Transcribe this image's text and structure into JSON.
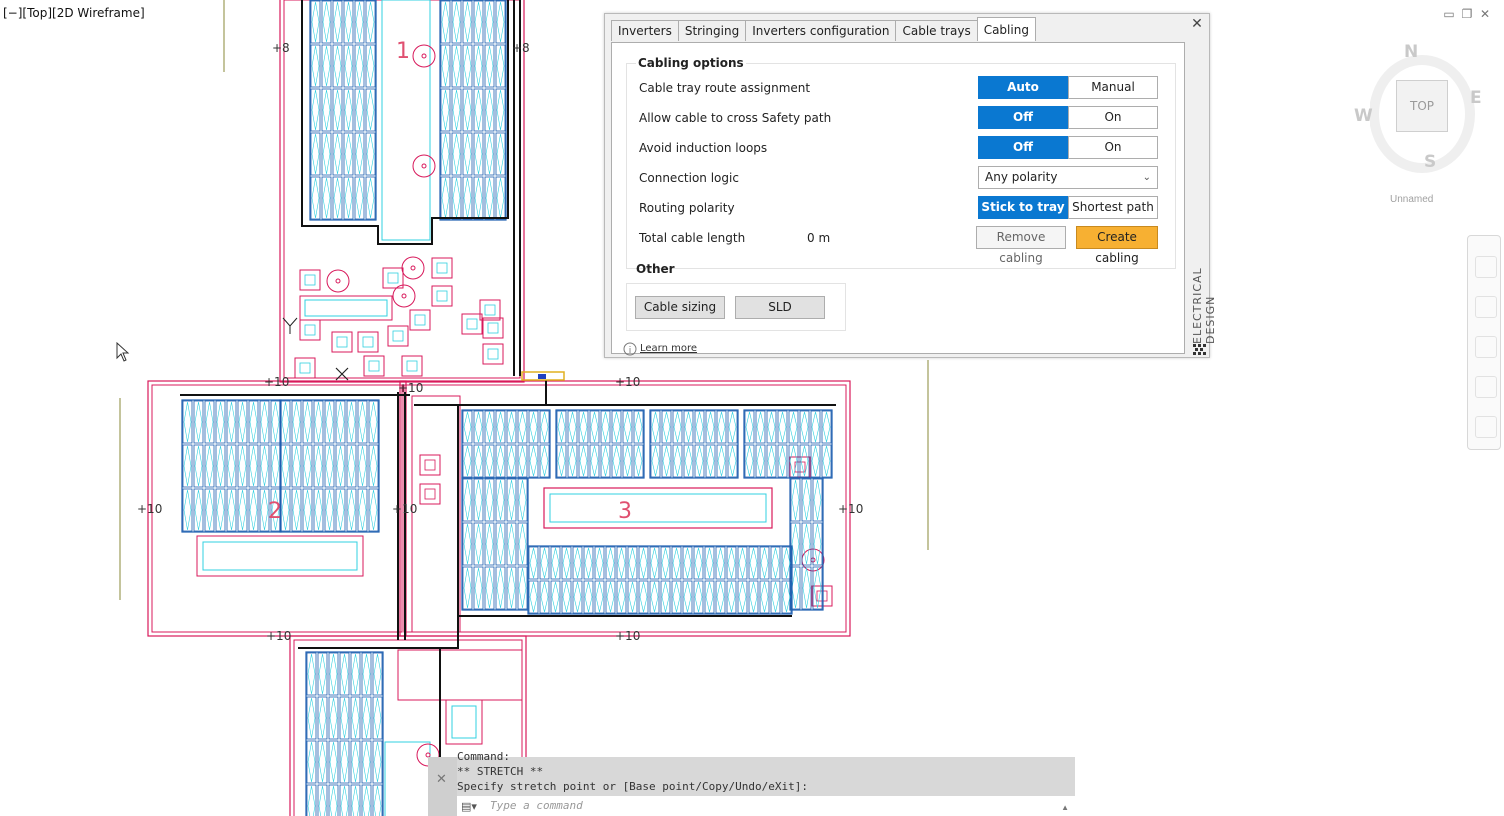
{
  "viewport": {
    "label": "[−][Top][2D Wireframe]"
  },
  "drawing": {
    "level_labels": [
      "+8",
      "+8",
      "+10",
      "+10",
      "+10",
      "+10",
      "+10",
      "+10",
      "+10",
      "+10"
    ],
    "zone_labels": [
      "1",
      "2",
      "3"
    ]
  },
  "dialog": {
    "tabs": [
      "Inverters",
      "Stringing",
      "Inverters configuration",
      "Cable trays",
      "Cabling"
    ],
    "active_tab": "Cabling",
    "cabling_options": {
      "title": "Cabling options",
      "route_assignment": {
        "label": "Cable tray route assignment",
        "options": [
          "Auto",
          "Manual"
        ],
        "selected": "Auto"
      },
      "cross_safety": {
        "label": "Allow cable to cross Safety path",
        "options": [
          "Off",
          "On"
        ],
        "selected": "Off"
      },
      "induction_loops": {
        "label": "Avoid induction loops",
        "options": [
          "Off",
          "On"
        ],
        "selected": "Off"
      },
      "connection_logic": {
        "label": "Connection logic",
        "value": "Any polarity"
      },
      "routing_polarity": {
        "label": "Routing polarity",
        "options": [
          "Stick to tray",
          "Shortest path"
        ],
        "selected": "Stick to tray"
      },
      "total_length": {
        "label": "Total cable length",
        "value": "0 m"
      },
      "remove_button": "Remove cabling",
      "create_button": "Create cabling"
    },
    "other": {
      "title": "Other",
      "cable_sizing": "Cable sizing",
      "sld": "SLD"
    },
    "learn_more": "Learn more",
    "side_label": "ELECTRICAL DESIGN"
  },
  "viewcube": {
    "north": "N",
    "south": "S",
    "east": "E",
    "west": "W",
    "face": "TOP",
    "ucs": "Unnamed"
  },
  "command_line": {
    "history": [
      "Command:",
      "** STRETCH **",
      "Specify stretch point or [Base point/Copy/Undo/eXit]:"
    ],
    "placeholder": "Type a command"
  },
  "colors": {
    "accent_blue": "#0a78d1",
    "create_orange": "#f7b032",
    "zone_magenta": "#d8195b",
    "panel_blue": "#1f5fb0",
    "cyan": "#30d0e0"
  }
}
